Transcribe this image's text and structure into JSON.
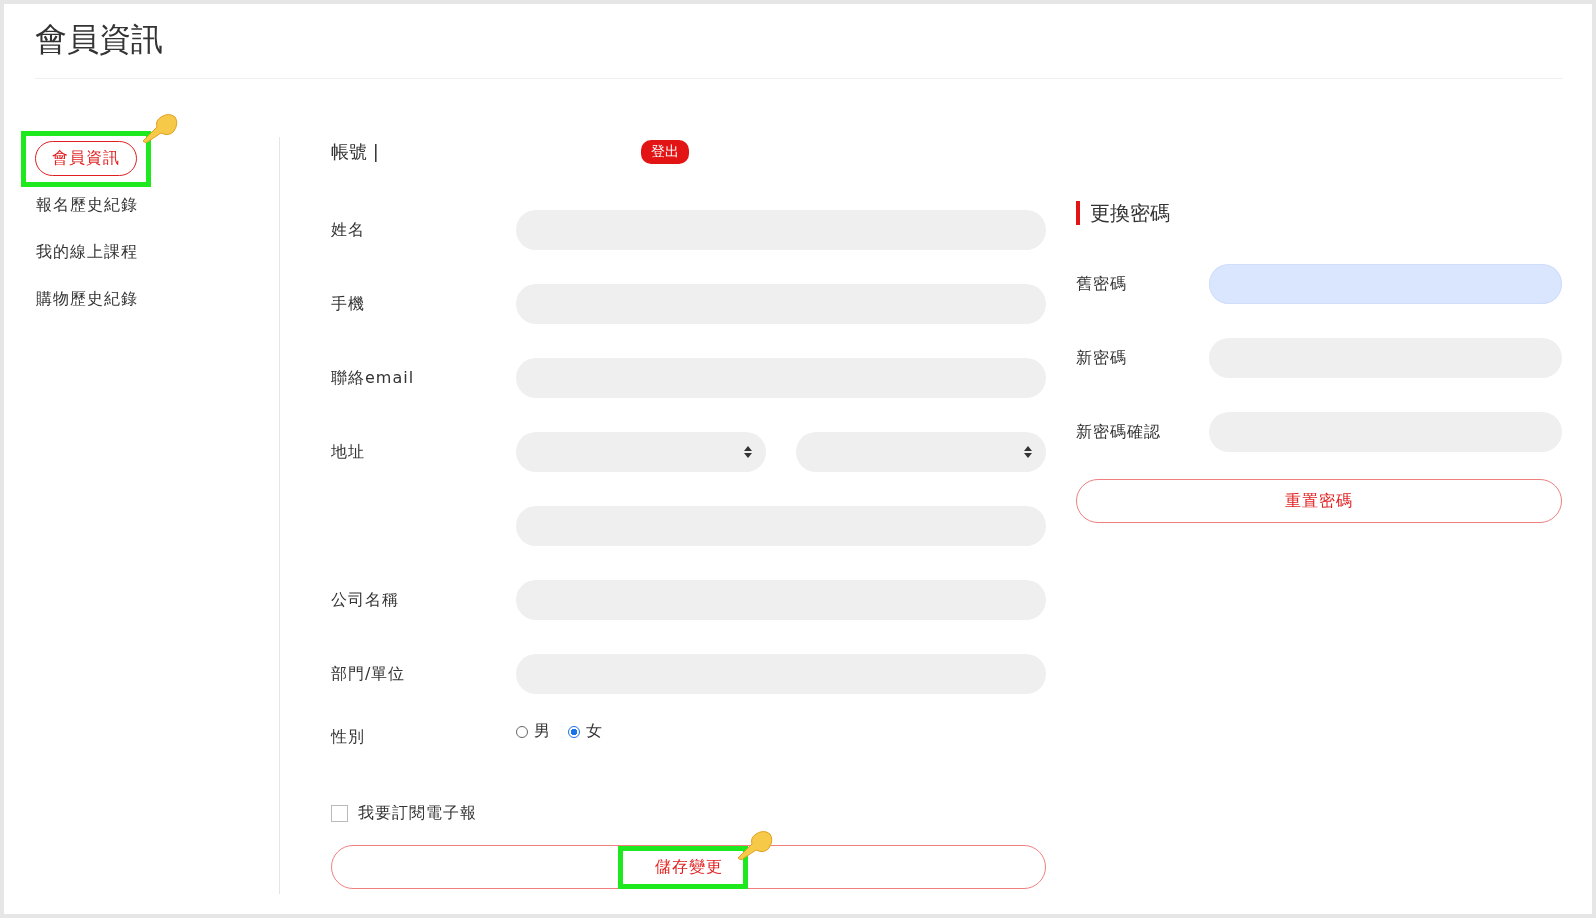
{
  "title": "會員資訊",
  "sidebar": {
    "items": [
      {
        "label": "會員資訊",
        "selected": true,
        "highlighted": true
      },
      {
        "label": "報名歷史紀錄",
        "selected": false,
        "highlighted": false
      },
      {
        "label": "我的線上課程",
        "selected": false,
        "highlighted": false
      },
      {
        "label": "購物歷史紀錄",
        "selected": false,
        "highlighted": false
      }
    ]
  },
  "account": {
    "label": "帳號",
    "separator": "|",
    "logout": "登出"
  },
  "profile": {
    "fields": [
      {
        "kind": "text",
        "label": "姓名"
      },
      {
        "kind": "text",
        "label": "手機"
      },
      {
        "kind": "text",
        "label": "聯絡email"
      },
      {
        "kind": "selects",
        "label": "地址"
      },
      {
        "kind": "text"
      },
      {
        "kind": "text",
        "label": "公司名稱"
      },
      {
        "kind": "text",
        "label": "部門/單位"
      },
      {
        "kind": "radio",
        "label": "性別",
        "options": [
          {
            "label": "男",
            "selected": false
          },
          {
            "label": "女",
            "selected": true
          }
        ]
      }
    ],
    "newsletter": {
      "label": "我要訂閱電子報",
      "checked": false
    },
    "save": {
      "label": "儲存變更",
      "highlighted": true
    }
  },
  "password": {
    "title": "更換密碼",
    "fields": [
      {
        "label": "舊密碼",
        "autofilled": true
      },
      {
        "label": "新密碼",
        "autofilled": false
      },
      {
        "label": "新密碼確認",
        "autofilled": false
      }
    ],
    "reset": "重置密碼"
  }
}
